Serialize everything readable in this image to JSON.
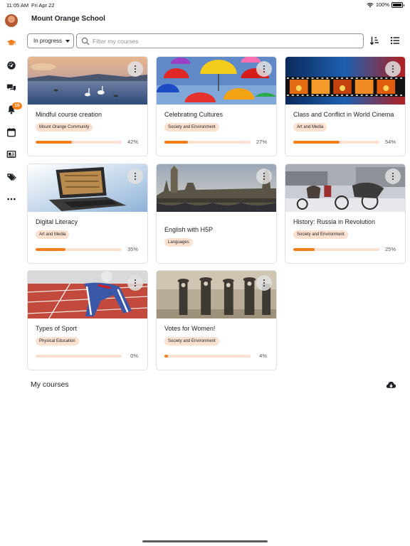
{
  "status_bar": {
    "time": "11:05 AM",
    "date": "Fri Apr 22",
    "battery": "100%"
  },
  "site": {
    "title": "Mount Orange School"
  },
  "sidebar": {
    "notification_count": "10"
  },
  "filters": {
    "selected": "In progress",
    "search_placeholder": "Filter my courses"
  },
  "courses": [
    {
      "title": "Mindful course creation",
      "category": "Mount Orange Community",
      "progress": 42,
      "progress_label": "42%"
    },
    {
      "title": "Celebrating Cultures",
      "category": "Society and Environment",
      "progress": 27,
      "progress_label": "27%"
    },
    {
      "title": "Class and Conflict in World Cinema",
      "category": "Art and Media",
      "progress": 54,
      "progress_label": "54%"
    },
    {
      "title": "Digital Literacy",
      "category": "Art and Media",
      "progress": 35,
      "progress_label": "35%"
    },
    {
      "title": "English with H5P",
      "category": "Languages"
    },
    {
      "title": "History: Russia in Revolution",
      "category": "Society and Environment",
      "progress": 25,
      "progress_label": "25%"
    },
    {
      "title": "Types of Sport",
      "category": "Physical Education",
      "progress": 0,
      "progress_label": "0%"
    },
    {
      "title": "Votes for Women!",
      "category": "Society and Environment",
      "progress": 4,
      "progress_label": "4%"
    }
  ],
  "my_courses": {
    "title": "My courses"
  },
  "colors": {
    "accent": "#f57d1b",
    "tag_bg": "#fce1d0",
    "badge": "#f98012"
  }
}
